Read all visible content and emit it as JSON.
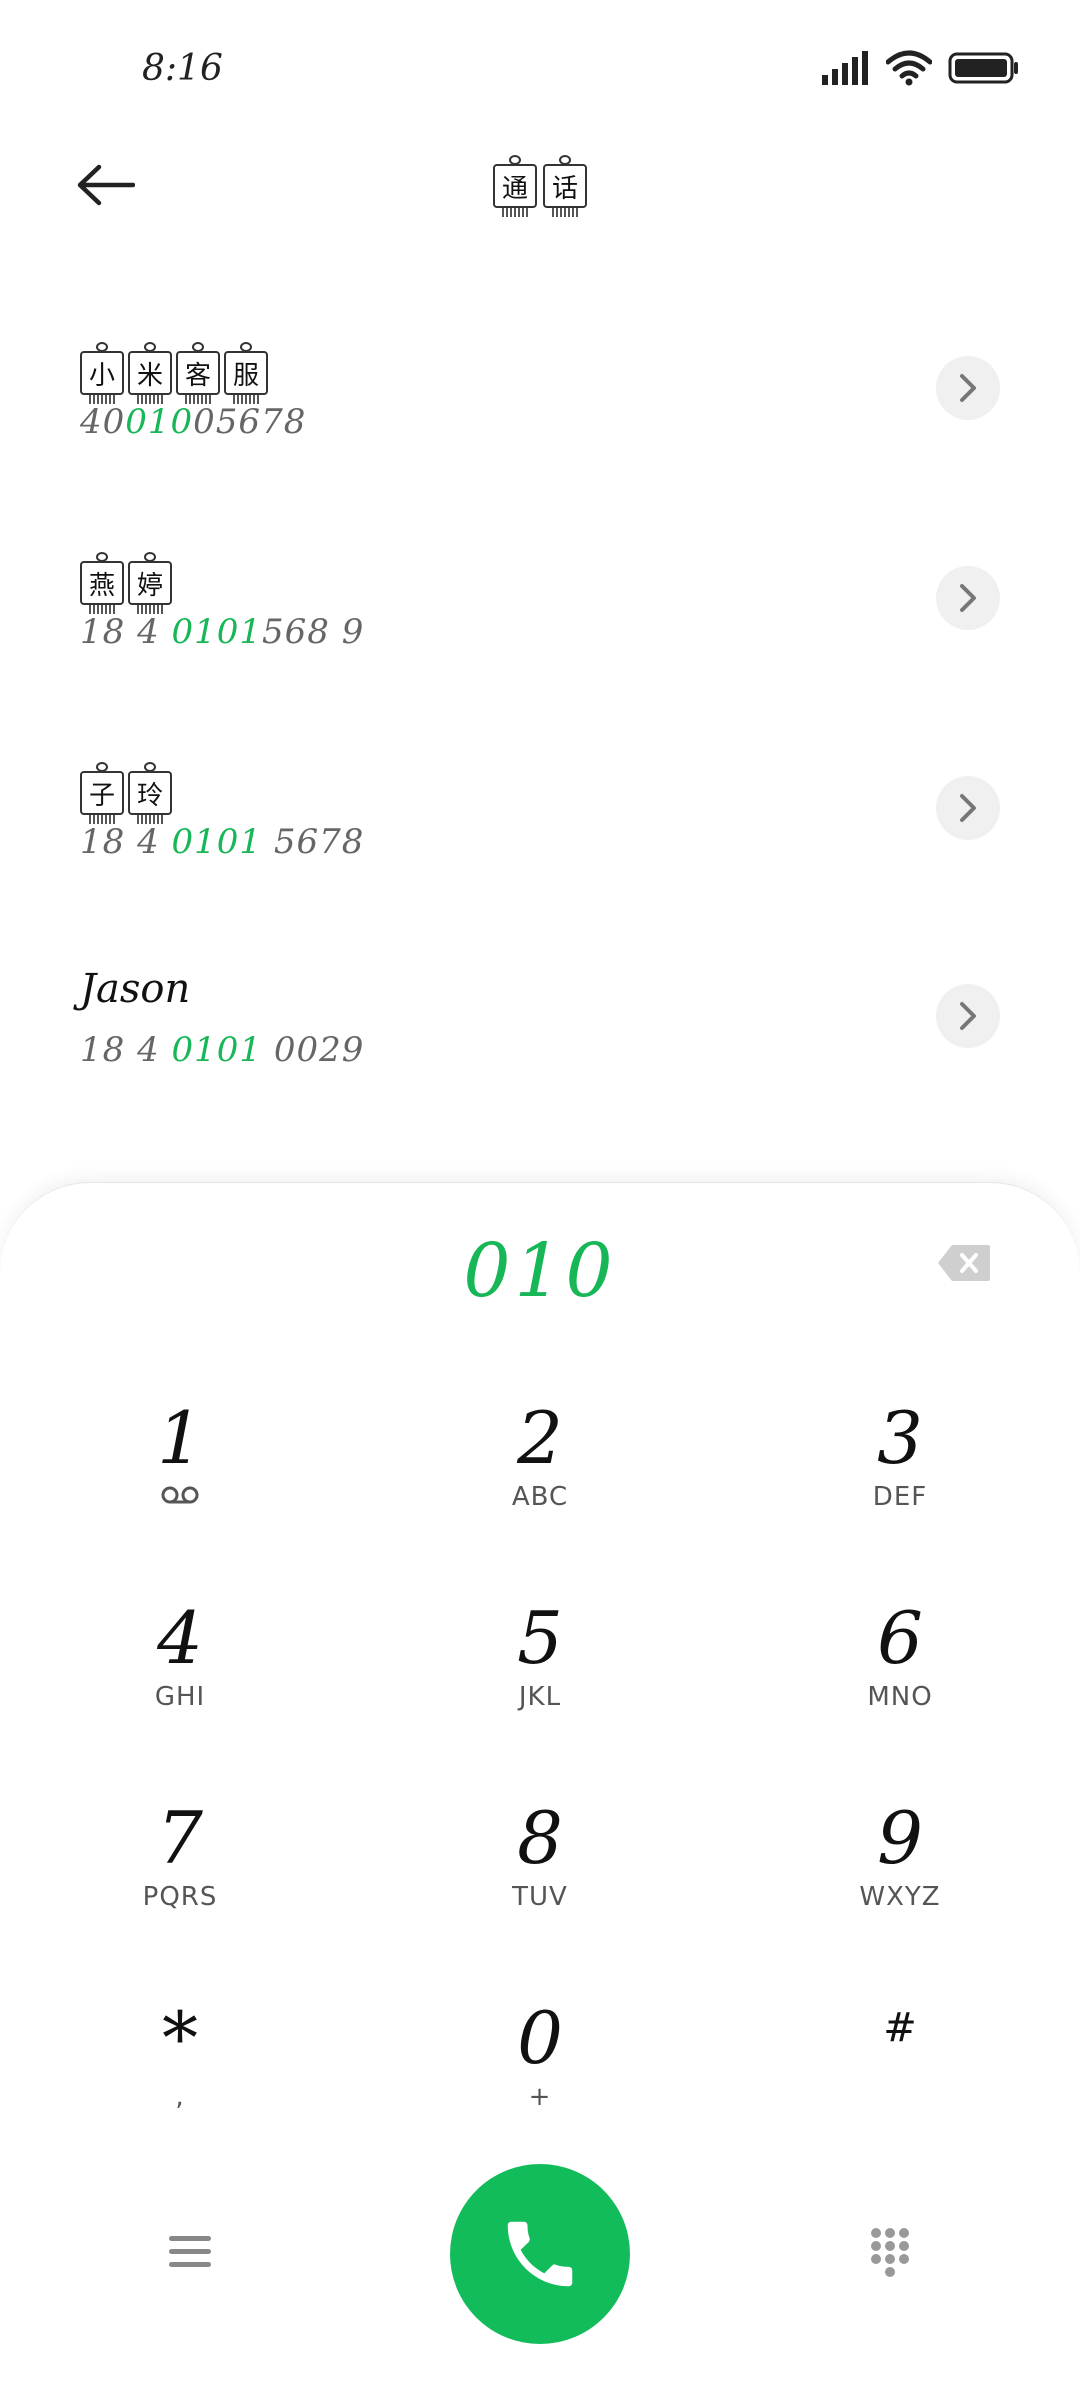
{
  "status_bar": {
    "time": "8:16"
  },
  "header": {
    "title_chars": [
      "通",
      "话"
    ]
  },
  "contacts": [
    {
      "name_chars": [
        "小",
        "米",
        "客",
        "服"
      ],
      "number_prefix": "40",
      "number_match": "010",
      "number_suffix": "05678"
    },
    {
      "name_chars": [
        "燕",
        "婷"
      ],
      "number_prefix": "18 4 ",
      "number_match": "0101",
      "number_suffix": "568 9"
    },
    {
      "name_chars": [
        "子",
        "玲"
      ],
      "number_prefix": "18 4 ",
      "number_match": "0101",
      "number_suffix": " 5678"
    },
    {
      "name": "Jason",
      "number_prefix": "18 4 ",
      "number_match": "0101",
      "number_suffix": " 0029"
    }
  ],
  "dialer": {
    "input": "010",
    "keys": [
      {
        "digit": "1",
        "letters": "oo"
      },
      {
        "digit": "2",
        "letters": "ABC"
      },
      {
        "digit": "3",
        "letters": "DEF"
      },
      {
        "digit": "4",
        "letters": "GHI"
      },
      {
        "digit": "5",
        "letters": "JKL"
      },
      {
        "digit": "6",
        "letters": "MNO"
      },
      {
        "digit": "7",
        "letters": "PQRS"
      },
      {
        "digit": "8",
        "letters": "TUV"
      },
      {
        "digit": "9",
        "letters": "WXYZ"
      },
      {
        "digit": "*",
        "letters": ","
      },
      {
        "digit": "0",
        "letters": "+"
      },
      {
        "digit": "#",
        "letters": ""
      }
    ]
  },
  "colors": {
    "accent": "#17b657",
    "call_button": "#12bc5a"
  },
  "icons": {
    "back": "back-arrow-icon",
    "chevron": "chevron-right-icon",
    "backspace": "backspace-icon",
    "menu": "menu-icon",
    "call": "phone-icon",
    "dialpad": "dialpad-icon",
    "signal": "signal-icon",
    "wifi": "wifi-icon",
    "battery": "battery-icon"
  }
}
